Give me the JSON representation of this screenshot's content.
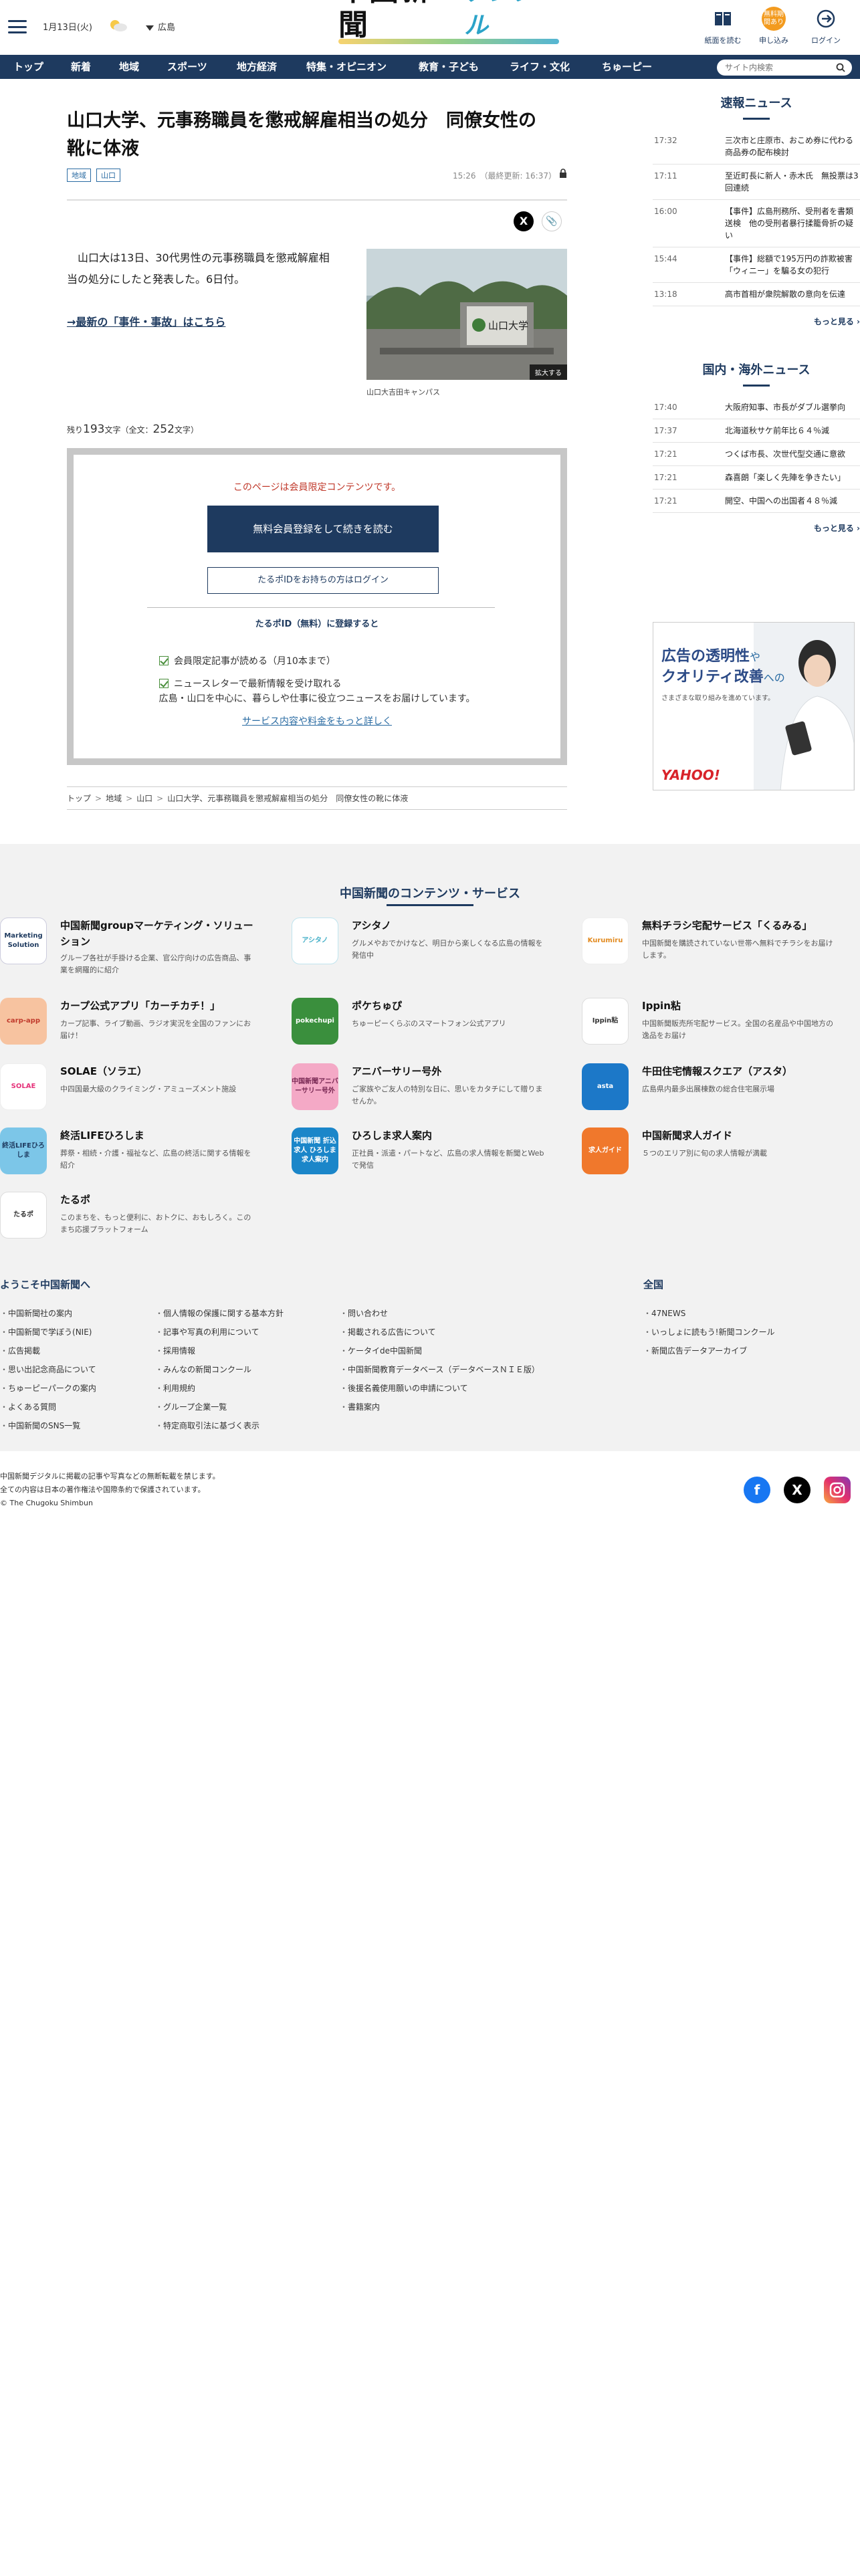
{
  "header": {
    "date": "1月13日(火)",
    "area": "広島",
    "logo_main": "中國新聞",
    "logo_sub": "デジタル",
    "btn_paper": "紙面を読む",
    "btn_apply": "申し込み",
    "btn_apply_badge": "無料期間あり",
    "btn_login": "ログイン"
  },
  "nav": {
    "items": [
      "トップ",
      "新着",
      "地域",
      "スポーツ",
      "地方経済",
      "特集・オピニオン",
      "教育・子ども",
      "ライフ・文化",
      "ちゅーピー"
    ],
    "search_placeholder": "サイト内検索"
  },
  "article": {
    "title_line1": "山口大学、元事務職員を懲戒解雇相当の処分　同僚女性の",
    "title_line2": "靴に体液",
    "tags": [
      "地域",
      "山口"
    ],
    "timestamp": "15:26　（最終更新: 16:37）",
    "lead": "山口大は13日、30代男性の元事務職員を懲戒解雇相当の処分にしたと発表した。6日付。",
    "latest_link": "→最新の「事件・事故」はこちら",
    "photo_zoom": "拡大する",
    "photo_caption": "山口大吉田キャンパス",
    "photo_sign": "山口大学",
    "remaining_prefix": "残り",
    "remaining_chars": "193",
    "remaining_mid": "文字（全文：",
    "total_chars": "252",
    "remaining_suffix": "文字）"
  },
  "paywall": {
    "notice": "このページは会員限定コンテンツです。",
    "register_button": "無料会員登録をして続きを読む",
    "login_button": "たるポIDをお持ちの方はログイン",
    "register_heading": "たるポID（無料）に登録すると",
    "benefits": [
      "会員限定記事が読める（月10本まで）",
      "ニュースレターで最新情報を受け取れる"
    ],
    "desc": "広島・山口を中心に、暮らしや仕事に役立つニュースをお届けしています。",
    "more_link": "サービス内容や料金をもっと詳しく"
  },
  "breadcrumb": [
    "トップ",
    "地域",
    "山口",
    "山口大学、元事務職員を懲戒解雇相当の処分　同僚女性の靴に体液"
  ],
  "sidebar": {
    "breaking_title": "速報ニュース",
    "breaking": [
      {
        "time": "17:32",
        "text": "三次市と庄原市、おこめ券に代わる商品券の配布検討"
      },
      {
        "time": "17:11",
        "text": "至近町長に新人・赤木氏　無投票は3回連続"
      },
      {
        "time": "16:00",
        "text": "【事件】広島刑務所、受刑者を書類送検　他の受刑者暴行揉籠骨折の疑い"
      },
      {
        "time": "15:44",
        "text": "【事件】総額で195万円の詐欺被害「ウィニー」を騙る女の犯行"
      },
      {
        "time": "13:18",
        "text": "高市首相が衆院解散の意向を伝達"
      }
    ],
    "breaking_more": "もっと見る ›",
    "domestic_title": "国内・海外ニュース",
    "domestic": [
      {
        "time": "17:40",
        "text": "大阪府知事、市長がダブル選挙向"
      },
      {
        "time": "17:37",
        "text": "北海道秋サケ前年比６４％減"
      },
      {
        "time": "17:21",
        "text": "つくば市長、次世代型交通に意欲"
      },
      {
        "time": "17:21",
        "text": "森喜朗「楽しく先陣を争きたい」"
      },
      {
        "time": "17:21",
        "text": "開空、中国への出国者４８％減"
      }
    ],
    "domestic_more": "もっと見る ›",
    "ad_line1": "広告の透明性",
    "ad_line1_tail": "や",
    "ad_line2": "クオリティ改善",
    "ad_line2_tail": "への",
    "ad_sub": "さまざまな取り組みを進めています。",
    "ad_logo": "YAHOO!"
  },
  "services": {
    "title": "中国新聞のコンテンツ・サービス",
    "items": [
      {
        "name": "中国新聞groupマーケティング・ソリューション",
        "desc": "グループ各社が手掛ける企業、官公庁向けの広告商品、事業を網羅的に紹介",
        "icon": "Marketing Solution"
      },
      {
        "name": "アシタノ",
        "desc": "グルメやおでかけなど、明日から楽しくなる広島の情報を発信中",
        "icon": "アシタノ"
      },
      {
        "name": "無料チラシ宅配サービス「くるみる」",
        "desc": "中国新聞を購読されていない世帯へ無料でチラシをお届けします。",
        "icon": "Kurumiru"
      },
      {
        "name": "カープ公式アプリ「カーチカチ！」",
        "desc": "カープ記事、ライブ動画、ラジオ実況を全国のファンにお届け！",
        "icon": "carp-app"
      },
      {
        "name": "ポケちゅぴ",
        "desc": "ちゅーピーくらぶのスマートフォン公式アプリ",
        "icon": "pokechupi"
      },
      {
        "name": "Ippin粘",
        "desc": "中国新聞販売所宅配サービス。全国の名産品や中国地方の逸品をお届け",
        "icon": "Ippin粘"
      },
      {
        "name": "SOLAE（ソラエ）",
        "desc": "中四国最大級のクライミング・アミューズメント施設",
        "icon": "SOLAE"
      },
      {
        "name": "アニバーサリー号外",
        "desc": "ご家族やご友人の特別な日に、思いをカタチにして贈りませんか。",
        "icon": "中国新聞アニバーサリー号外"
      },
      {
        "name": "牛田住宅情報スクエア（アスタ）",
        "desc": "広島県内最多出展棟数の総合住宅展示場",
        "icon": "asta"
      },
      {
        "name": "終活LIFEひろしま",
        "desc": "葬祭・相続・介護・福祉など、広島の終活に関する情報を紹介",
        "icon": "終活LIFEひろしま"
      },
      {
        "name": "ひろしま求人案内",
        "desc": "正社員・派遣・パートなど、広島の求人情報を新聞とWebで発信",
        "icon": "中国新聞 折込求人 ひろしま求人案内"
      },
      {
        "name": "中国新聞求人ガイド",
        "desc": "５つのエリア別に旬の求人情報が満載",
        "icon": "求人ガイド"
      },
      {
        "name": "たるポ",
        "desc": "このまちを、もっと便利に、おトクに、おもしろく。このまち応援プラットフォーム",
        "icon": "たるポ"
      }
    ]
  },
  "footer": {
    "welcome_title": "ようこそ中国新聞へ",
    "col1": [
      "中国新聞社の案内",
      "中国新聞で学ぼう(NIE)",
      "広告掲載",
      "思い出記念商品について",
      "ちゅーピーパークの案内",
      "よくある質問",
      "中国新聞のSNS一覧"
    ],
    "col2": [
      "個人情報の保護に関する基本方針",
      "記事や写真の利用について",
      "採用情報",
      "みんなの新聞コンクール",
      "利用規約",
      "グループ企業一覧",
      "特定商取引法に基づく表示"
    ],
    "col3": [
      "問い合わせ",
      "掲載される広告について",
      "ケータイde中国新聞",
      "中国新聞教育データベース（データベースＮＩＥ版）",
      "後援名義使用願いの申請について",
      "書籍案内"
    ],
    "national_title": "全国",
    "national": [
      "47NEWS",
      "いっしょに読もう!新聞コンクール",
      "新聞広告データアーカイブ"
    ],
    "copyright1": "中国新聞デジタルに掲載の記事や写真などの無断転載を禁じます。",
    "copyright2": "全ての内容は日本の著作権法や国際条約で保護されています。",
    "copyright3": "© The Chugoku Shimbun"
  },
  "colors": {
    "navy": "#1e3a5f",
    "accent_orange": "#f39b1f",
    "link_blue": "#2b6ca3",
    "notice_red": "#c0392b"
  }
}
